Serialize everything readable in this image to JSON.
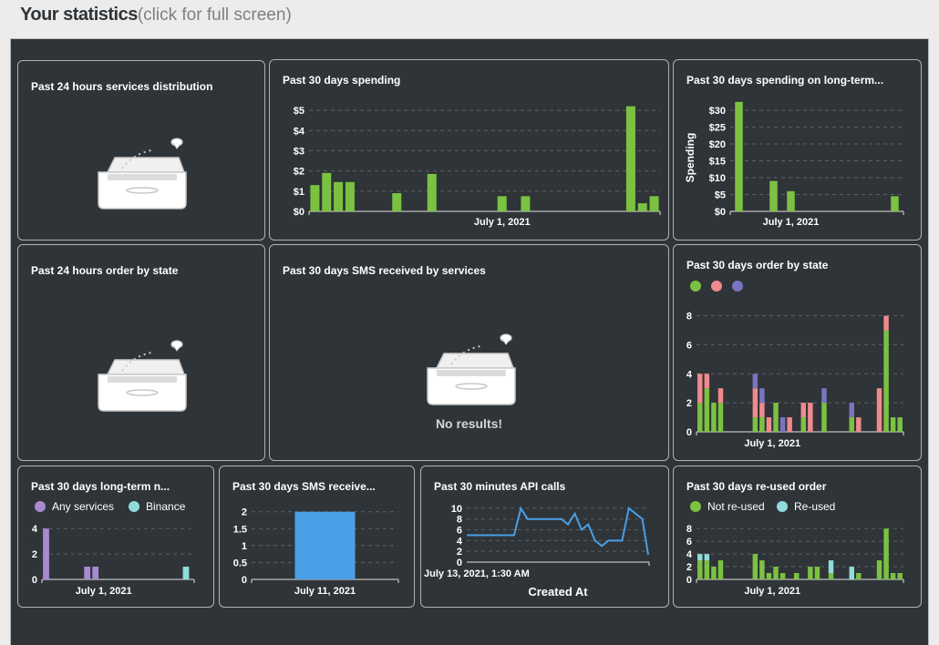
{
  "header": {
    "title": "Your statistics",
    "link": "(click for full screen)"
  },
  "colors": {
    "green": "#7cc242",
    "red": "#f08a8c",
    "purple": "#7a75c0",
    "lilac": "#a88ad0",
    "cyan": "#8fdcdb",
    "blue": "#4aa0e6",
    "lineblue": "#4a9fe6"
  },
  "panels": {
    "svc24": {
      "title": "Past 24 hours services distribution"
    },
    "state24": {
      "title": "Past 24 hours order by state"
    },
    "sms30": {
      "title": "Past 30 days SMS received by services",
      "empty_text": "No results!"
    }
  },
  "chart_data": [
    {
      "id": "spending30",
      "type": "bar",
      "title": "Past 30 days spending",
      "xlabel": "",
      "ylabel": "",
      "ylim": [
        0,
        5.5
      ],
      "yticks": [
        0,
        1,
        2,
        3,
        4,
        5
      ],
      "yticklabels": [
        "$0",
        "$1",
        "$2",
        "$3",
        "$4",
        "$5"
      ],
      "xtick": {
        "x": 16,
        "label": "July 1, 2021"
      },
      "x": [
        0,
        1,
        2,
        3,
        7,
        10,
        16,
        18,
        27,
        28,
        29
      ],
      "values": [
        1.3,
        1.9,
        1.45,
        1.45,
        0.9,
        1.85,
        0.75,
        0.75,
        5.2,
        0.4,
        0.75
      ],
      "xrange": [
        -0.5,
        29.5
      ],
      "grid": true
    },
    {
      "id": "spendingLT",
      "type": "bar",
      "title": "Past 30 days spending on long-term...",
      "xlabel": "",
      "ylabel": "Spending",
      "ylim": [
        0,
        33
      ],
      "yticks": [
        0,
        5,
        10,
        15,
        20,
        25,
        30
      ],
      "yticklabels": [
        "$0",
        "$5",
        "$10",
        "$15",
        "$20",
        "$25",
        "$30"
      ],
      "xtick": {
        "x": 3,
        "label": "July 1, 2021"
      },
      "x": [
        0,
        2,
        3,
        9
      ],
      "values": [
        32.5,
        9,
        6,
        4.5
      ],
      "xrange": [
        -0.5,
        9.5
      ],
      "grid": true
    },
    {
      "id": "state30",
      "type": "bar",
      "stacked": true,
      "title": "Past 30 days order by state",
      "legend_colors": [
        "#7cc242",
        "#f08a8c",
        "#7a75c0"
      ],
      "ylim": [
        0,
        8.6
      ],
      "yticks": [
        0,
        2,
        4,
        6,
        8
      ],
      "yticklabels": [
        "0",
        "2",
        "4",
        "6",
        "8"
      ],
      "xtick": {
        "x": 10.5,
        "label": "July 1, 2021"
      },
      "categories": [
        0,
        1,
        2,
        3,
        4,
        5,
        6,
        7,
        8,
        9,
        10,
        11,
        12,
        13,
        14,
        15,
        16,
        17,
        18,
        19,
        20,
        21,
        22,
        23,
        24,
        25,
        26,
        27,
        28,
        29
      ],
      "series": [
        {
          "values": [
            2,
            3,
            2,
            2,
            0,
            0,
            0,
            0,
            1,
            1,
            0,
            2,
            0,
            0,
            0,
            1,
            0,
            0,
            2,
            0,
            0,
            0,
            1,
            0,
            0,
            0,
            0,
            7,
            1,
            1
          ]
        },
        {
          "values": [
            2,
            1,
            0,
            1,
            0,
            0,
            0,
            0,
            2,
            1,
            1,
            0,
            0,
            1,
            0,
            1,
            2,
            0,
            0,
            0,
            0,
            0,
            0,
            1,
            0,
            0,
            3,
            1,
            0,
            0
          ]
        },
        {
          "values": [
            0,
            0,
            0,
            0,
            0,
            0,
            0,
            0,
            1,
            1,
            0,
            0,
            1,
            0,
            0,
            0,
            0,
            0,
            1,
            0,
            0,
            0,
            1,
            0,
            0,
            0,
            0,
            0,
            0,
            0
          ]
        }
      ],
      "xrange": [
        -0.5,
        29.5
      ],
      "grid": true
    },
    {
      "id": "longterm30",
      "type": "bar",
      "title": "Past 30 days long-term n...",
      "legend": [
        "Any services",
        "Binance"
      ],
      "ylim": [
        0,
        4.3
      ],
      "yticks": [
        0,
        2,
        4
      ],
      "yticklabels": [
        "0",
        "2",
        "4"
      ],
      "xtick": {
        "x": 7,
        "label": "July 1, 2021"
      },
      "x": [
        0,
        5,
        6,
        17
      ],
      "values": [
        4,
        1,
        1,
        1
      ],
      "series_index": [
        0,
        0,
        0,
        1
      ],
      "xrange": [
        -0.5,
        18
      ],
      "grid": true
    },
    {
      "id": "smsrecv",
      "type": "bar",
      "title": "Past 30 days SMS receive...",
      "ylim": [
        0,
        2.1
      ],
      "yticks": [
        0,
        0.5,
        1,
        1.5,
        2
      ],
      "yticklabels": [
        "0",
        "0.5",
        "1",
        "1.5",
        "2"
      ],
      "categories": [
        "July 11, 2021"
      ],
      "values": [
        2
      ],
      "grid": true
    },
    {
      "id": "api30",
      "type": "line",
      "title": "Past 30 minutes API calls",
      "xlabel": "Created At",
      "ylim": [
        0,
        11
      ],
      "yticks": [
        0,
        2,
        4,
        6,
        8,
        10
      ],
      "yticklabels": [
        "0",
        "2",
        "4",
        "6",
        "8",
        "10"
      ],
      "xtick": {
        "x": 0,
        "label": "July 13, 2021, 1:30 AM"
      },
      "x": [
        0,
        1,
        2,
        3,
        4,
        5,
        6,
        7,
        8,
        9,
        10,
        11,
        12,
        13,
        14,
        15,
        16,
        17,
        18,
        19,
        20,
        21,
        22,
        23,
        24,
        25,
        26
      ],
      "values": [
        5,
        5,
        5,
        5,
        5,
        5,
        5,
        5,
        10,
        8,
        8,
        8,
        8,
        8,
        8,
        7,
        9,
        6,
        7,
        4,
        3,
        4,
        4,
        4,
        10,
        9,
        8
      ],
      "tail": 1,
      "grid": true
    },
    {
      "id": "reused30",
      "type": "bar",
      "stacked": true,
      "title": "Past 30 days re-used order",
      "legend": [
        "Not re-used",
        "Re-used"
      ],
      "ylim": [
        0,
        8.6
      ],
      "yticks": [
        0,
        2,
        4,
        6,
        8
      ],
      "yticklabels": [
        "0",
        "2",
        "4",
        "6",
        "8"
      ],
      "xtick": {
        "x": 10.5,
        "label": "July 1, 2021"
      },
      "categories": [
        0,
        1,
        2,
        3,
        4,
        5,
        6,
        7,
        8,
        9,
        10,
        11,
        12,
        13,
        14,
        15,
        16,
        17,
        18,
        19,
        20,
        21,
        22,
        23,
        24,
        25,
        26,
        27,
        28,
        29
      ],
      "series": [
        {
          "values": [
            3,
            3,
            2,
            3,
            0,
            0,
            0,
            0,
            4,
            3,
            1,
            2,
            1,
            0,
            1,
            0,
            2,
            2,
            0,
            1,
            0,
            0,
            0,
            1,
            0,
            0,
            3,
            8,
            1,
            1
          ]
        },
        {
          "values": [
            1,
            1,
            0,
            0,
            0,
            0,
            0,
            0,
            0,
            0,
            0,
            0,
            0,
            0,
            0,
            0,
            0,
            0,
            0,
            2,
            0,
            0,
            2,
            0,
            0,
            0,
            0,
            0,
            0,
            0
          ]
        }
      ],
      "xrange": [
        -0.5,
        29.5
      ],
      "grid": true
    }
  ]
}
